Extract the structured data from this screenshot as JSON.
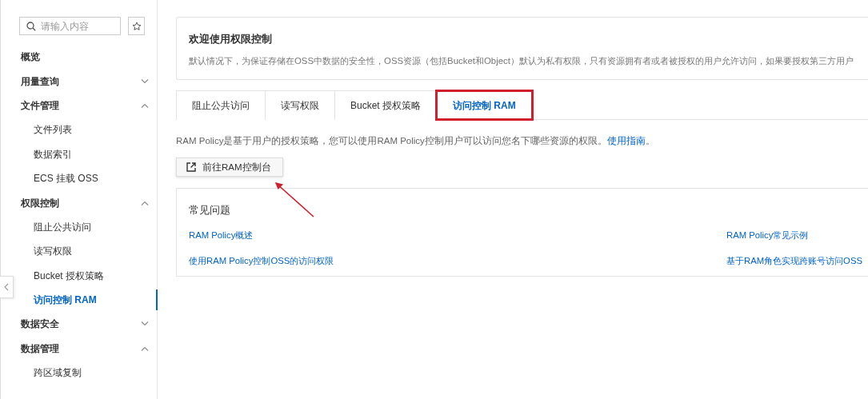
{
  "sidebar": {
    "search": {
      "placeholder": "请输入内容"
    },
    "items": [
      {
        "kind": "group",
        "label": "概览"
      },
      {
        "kind": "group",
        "label": "用量查询",
        "expanded": false
      },
      {
        "kind": "group",
        "label": "文件管理",
        "expanded": true
      },
      {
        "kind": "child",
        "label": "文件列表",
        "selected": false
      },
      {
        "kind": "child",
        "label": "数据索引",
        "selected": false
      },
      {
        "kind": "child",
        "label": "ECS 挂载 OSS",
        "selected": false
      },
      {
        "kind": "group",
        "label": "权限控制",
        "expanded": true
      },
      {
        "kind": "child",
        "label": "阻止公共访问",
        "selected": false
      },
      {
        "kind": "child",
        "label": "读写权限",
        "selected": false
      },
      {
        "kind": "child",
        "label": "Bucket 授权策略",
        "selected": false
      },
      {
        "kind": "child",
        "label": "访问控制 RAM",
        "selected": true
      },
      {
        "kind": "group",
        "label": "数据安全",
        "expanded": false
      },
      {
        "kind": "group",
        "label": "数据管理",
        "expanded": true
      },
      {
        "kind": "child",
        "label": "跨区域复制",
        "selected": false
      }
    ]
  },
  "welcome": {
    "title": "欢迎使用权限控制",
    "text": "默认情况下，为保证存储在OSS中数据的安全性，OSS资源（包括Bucket和Object）默认为私有权限，只有资源拥有者或者被授权的用户允许访问，如果要授权第三方用户"
  },
  "tabs": [
    {
      "label": "阻止公共访问",
      "selected": false
    },
    {
      "label": "读写权限",
      "selected": false
    },
    {
      "label": "Bucket 授权策略",
      "selected": false
    },
    {
      "label": "访问控制 RAM",
      "selected": true
    }
  ],
  "description": {
    "text": "RAM Policy是基于用户的授权策略，您可以使用RAM Policy控制用户可以访问您名下哪些资源的权限。",
    "link": "使用指南",
    "end": "。"
  },
  "console_button": "前往RAM控制台",
  "faq": {
    "title": "常见问题",
    "links": [
      "RAM Policy概述",
      "RAM Policy常见示例",
      "使用RAM Policy控制OSS的访问权限",
      "基于RAM角色实现跨账号访问OSS"
    ]
  }
}
